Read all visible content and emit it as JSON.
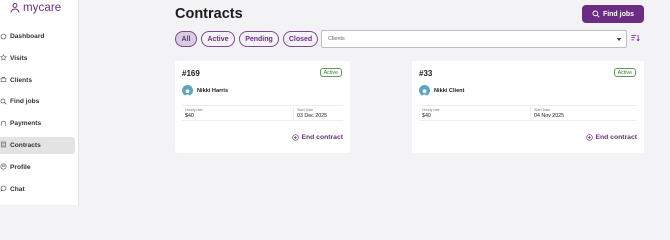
{
  "app": {
    "logo_text": "mycare",
    "brand_color": "#6b2d84"
  },
  "sidebar": {
    "items": [
      {
        "label": "Dashboard",
        "icon": "dashboard-icon",
        "active": false
      },
      {
        "label": "Visits",
        "icon": "visits-icon",
        "active": false
      },
      {
        "label": "Clients",
        "icon": "clients-icon",
        "active": false
      },
      {
        "label": "Find jobs",
        "icon": "search-icon",
        "active": false
      },
      {
        "label": "Payments",
        "icon": "payments-icon",
        "active": false
      },
      {
        "label": "Contracts",
        "icon": "contracts-icon",
        "active": true
      },
      {
        "label": "Profile",
        "icon": "profile-icon",
        "active": false
      },
      {
        "label": "Chat",
        "icon": "chat-icon",
        "active": false
      }
    ]
  },
  "header": {
    "title": "Contracts",
    "find_jobs_label": "Find jobs"
  },
  "filters": {
    "tabs": [
      {
        "label": "All",
        "selected": true
      },
      {
        "label": "Active",
        "selected": false
      },
      {
        "label": "Pending",
        "selected": false
      },
      {
        "label": "Closed",
        "selected": false
      }
    ],
    "clients_placeholder": "Clients"
  },
  "contracts": [
    {
      "number": "#169",
      "status": "Active",
      "client_name": "Nikki Harris",
      "hourly_rate_label": "Hourly rate",
      "hourly_rate": "$40",
      "start_date_label": "Start Date",
      "start_date": "03 Dec 2025",
      "end_label": "End contract"
    },
    {
      "number": "#33",
      "status": "Active",
      "client_name": "Nikki Client",
      "hourly_rate_label": "Hourly rate",
      "hourly_rate": "$40",
      "start_date_label": "Start Date",
      "start_date": "04 Nov 2025",
      "end_label": "End contract"
    }
  ]
}
